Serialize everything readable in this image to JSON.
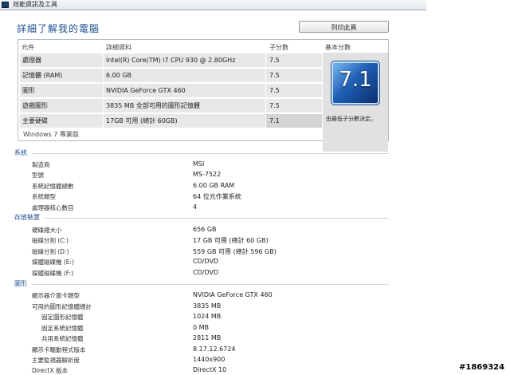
{
  "window": {
    "title": "效能資訊及工具"
  },
  "page": {
    "title": "詳細了解我的電腦",
    "print_button": "列印此頁"
  },
  "score_table": {
    "headers": {
      "component": "元件",
      "details": "詳細資料",
      "subscore": "子分數",
      "base_score": "基本分數"
    },
    "rows": [
      {
        "component": "處理器",
        "details": "Intel(R) Core(TM) i7 CPU 930 @ 2.80GHz",
        "subscore": "7.5"
      },
      {
        "component": "記憶體 (RAM)",
        "details": "6.00 GB",
        "subscore": "7.5"
      },
      {
        "component": "圖形",
        "details": "NVIDIA GeForce GTX 460",
        "subscore": "7.5"
      },
      {
        "component": "遊戲圖形",
        "details": "3835 MB 全部可用的圖形記憶體",
        "subscore": "7.5"
      },
      {
        "component": "主要硬碟",
        "details": "17GB 可用 (總計 60GB)",
        "subscore": "7.1"
      }
    ],
    "base_score": "7.1",
    "base_note": "由最低子分數決定。",
    "windows_edition": "Windows 7 專業版"
  },
  "sections": {
    "system": {
      "title": "系統",
      "rows": [
        {
          "label": "製造商",
          "value": "MSI"
        },
        {
          "label": "型號",
          "value": "MS-7522"
        },
        {
          "label": "系統記憶體總數",
          "value": "6.00 GB RAM"
        },
        {
          "label": "系統類型",
          "value": "64 位元作業系統"
        },
        {
          "label": "處理器核心數目",
          "value": "4"
        }
      ]
    },
    "storage": {
      "title": "存放裝置",
      "rows": [
        {
          "label": "硬碟總大小",
          "value": "656 GB"
        },
        {
          "label": "磁碟分割 (C:)",
          "value": "17 GB 可用 (總計 60 GB)"
        },
        {
          "label": "磁碟分割 (D:)",
          "value": "559 GB 可用 (總計 596 GB)"
        },
        {
          "label": "媒體磁碟機 (E:)",
          "value": "CD/DVD"
        },
        {
          "label": "媒體磁碟機 (F:)",
          "value": "CD/DVD"
        }
      ]
    },
    "graphics": {
      "title": "圖形",
      "rows": [
        {
          "label": "顯示器介面卡類型",
          "value": "NVIDIA GeForce GTX 460"
        },
        {
          "label": "可用的圖形記憶體總計",
          "value": "3835 MB"
        },
        {
          "label": "固定圖形記憶體",
          "value": "1024 MB"
        },
        {
          "label": "固定系統記憶體",
          "value": "0 MB"
        },
        {
          "label": "共用系統記憶體",
          "value": "2811 MB"
        },
        {
          "label": "顯示卡驅動程式版本",
          "value": "8.17.12.6724"
        },
        {
          "label": "主要監視器解析度",
          "value": "1440x900"
        },
        {
          "label": "DirectX 版本",
          "value": "DirectX 10"
        }
      ]
    }
  },
  "watermark": "#1869324",
  "icons": {
    "window_icon": "performance-tools-icon"
  }
}
